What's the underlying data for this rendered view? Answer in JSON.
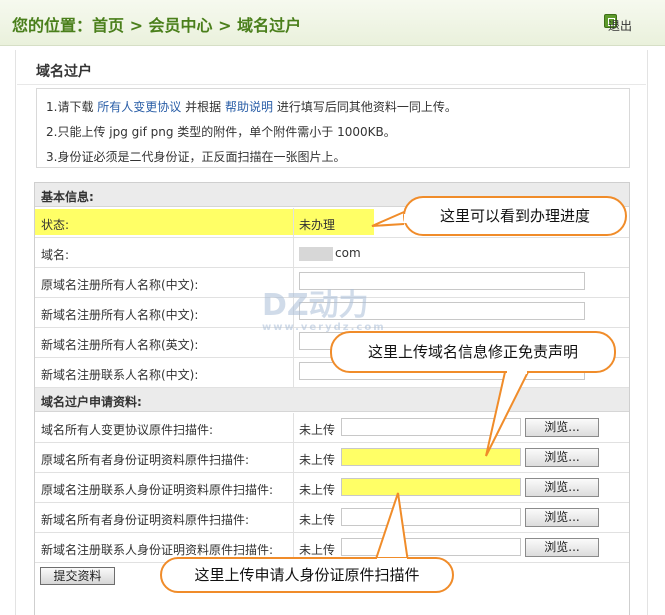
{
  "header": {
    "breadcrumb": "您的位置：首页 > 会员中心 > 域名过户",
    "logout": "退出"
  },
  "panel": {
    "title": "域名过户"
  },
  "notes": {
    "line1_prefix": "1.请下载",
    "line1_link1": "所有人变更协议",
    "line1_mid": "并根据",
    "line1_link2": "帮助说明",
    "line1_suffix": "进行填写后同其他资料一同上传。",
    "line2": "2.只能上传 jpg gif png 类型的附件，单个附件需小于  1000KB。",
    "line3": "3.身份证必须是二代身份证，正反面扫描在一张图片上。"
  },
  "basic": {
    "heading": "基本信息:",
    "status_label": "状态:",
    "status_value": "未办理",
    "domain_label": "域名:",
    "domain_suffix": "com",
    "rows": [
      {
        "label": "原域名注册所有人名称(中文):"
      },
      {
        "label": "新域名注册所有人名称(中文):"
      },
      {
        "label": "新域名注册所有人名称(英文):"
      },
      {
        "label": "新域名注册联系人名称(中文):"
      }
    ]
  },
  "transfer": {
    "heading": "域名过户申请资料:",
    "status_text": "未上传",
    "browse_label": "浏览...",
    "rows": [
      {
        "label": "域名所有人变更协议原件扫描件:"
      },
      {
        "label": "原域名所有者身份证明资料原件扫描件:"
      },
      {
        "label": "原域名注册联系人身份证明资料原件扫描件:"
      },
      {
        "label": "新域名所有者身份证明资料原件扫描件:"
      },
      {
        "label": "新域名注册联系人身份证明资料原件扫描件:"
      }
    ]
  },
  "submit_label": "提交资料",
  "callouts": {
    "progress": "这里可以看到办理进度",
    "domain_info": "这里上传域名信息修正免责声明",
    "id_scan": "这里上传申请人身份证原件扫描件"
  },
  "watermark": {
    "main": "DZ动力",
    "sub": "www.verydz.com"
  },
  "colors": {
    "accent_green": "#4a7f1b",
    "link_blue": "#2a5ea7",
    "highlight": "#ffff66",
    "callout_border": "#f08c2a"
  }
}
